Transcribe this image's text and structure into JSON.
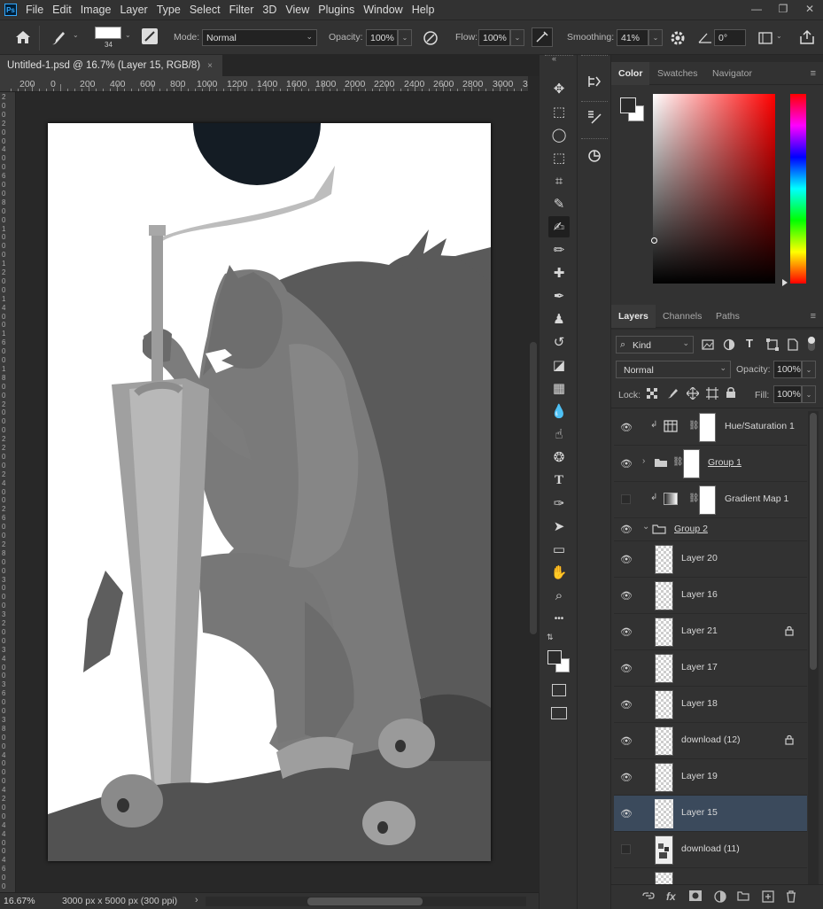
{
  "app": {
    "logo_text": "Ps"
  },
  "menu": [
    "File",
    "Edit",
    "Image",
    "Layer",
    "Type",
    "Select",
    "Filter",
    "3D",
    "View",
    "Plugins",
    "Window",
    "Help"
  ],
  "window_controls": {
    "minimize": "—",
    "restore": "❐",
    "close": "✕"
  },
  "options_bar": {
    "brush_size": "34",
    "mode_label": "Mode:",
    "mode_value": "Normal",
    "opacity_label": "Opacity:",
    "opacity_value": "100%",
    "flow_label": "Flow:",
    "flow_value": "100%",
    "smoothing_label": "Smoothing:",
    "smoothing_value": "41%",
    "angle_value": "0°"
  },
  "document": {
    "tab_title": "Untitled-1.psd @ 16.7% (Layer 15, RGB/8)",
    "tab_close": "×",
    "ruler_top_labels": [
      "200",
      "0",
      "200",
      "400",
      "600",
      "800",
      "1000",
      "1200",
      "1400",
      "1600",
      "1800",
      "2000",
      "2200",
      "2400",
      "2600",
      "2800",
      "3000",
      "3"
    ],
    "ruler_left_labels": [
      "2",
      "0",
      "0",
      "2",
      "0",
      "0",
      "4",
      "0",
      "0",
      "6",
      "0",
      "0",
      "8",
      "0",
      "0",
      "1",
      "0",
      "0",
      "0",
      "1",
      "2",
      "0",
      "0",
      "1",
      "4",
      "0",
      "0",
      "1",
      "6",
      "0",
      "0",
      "1",
      "8",
      "0",
      "0",
      "2",
      "0",
      "0",
      "0",
      "2",
      "2",
      "0",
      "0",
      "2",
      "4",
      "0",
      "0",
      "2",
      "6",
      "0",
      "0",
      "2",
      "8",
      "0",
      "0",
      "3",
      "0",
      "0",
      "0",
      "3",
      "2",
      "0",
      "0",
      "3",
      "4",
      "0",
      "0",
      "3",
      "6",
      "0",
      "0",
      "3",
      "8",
      "0",
      "0",
      "4",
      "0",
      "0",
      "0",
      "4",
      "2",
      "0",
      "0",
      "4",
      "4",
      "0",
      "0",
      "4",
      "6",
      "0",
      "0"
    ],
    "status_zoom": "16.67%",
    "status_docsize": "3000 px x 5000 px (300 ppi)",
    "status_arrow": "›"
  },
  "tools": [
    {
      "name": "move-tool",
      "glyph": "✥"
    },
    {
      "name": "marquee-tool",
      "glyph": "⬚"
    },
    {
      "name": "lasso-tool",
      "glyph": "◯"
    },
    {
      "name": "object-select-tool",
      "glyph": "⬚"
    },
    {
      "name": "crop-tool",
      "glyph": "⌗"
    },
    {
      "name": "eyedropper-tool",
      "glyph": "✎"
    },
    {
      "name": "brush-tool",
      "glyph": "✍"
    },
    {
      "name": "pencil-tool",
      "glyph": "✏"
    },
    {
      "name": "healing-brush-tool",
      "glyph": "✚"
    },
    {
      "name": "mixer-brush-tool",
      "glyph": "✒"
    },
    {
      "name": "clone-stamp-tool",
      "glyph": "♟"
    },
    {
      "name": "history-brush-tool",
      "glyph": "↺"
    },
    {
      "name": "eraser-tool",
      "glyph": "◪"
    },
    {
      "name": "gradient-tool",
      "glyph": "▦"
    },
    {
      "name": "blur-tool",
      "glyph": "💧"
    },
    {
      "name": "smudge-tool",
      "glyph": "☝"
    },
    {
      "name": "sponge-tool",
      "glyph": "❂"
    },
    {
      "name": "type-tool",
      "glyph": "T"
    },
    {
      "name": "pen-tool",
      "glyph": "✑"
    },
    {
      "name": "path-select-tool",
      "glyph": "➤"
    },
    {
      "name": "rectangle-tool",
      "glyph": "▭"
    },
    {
      "name": "hand-tool",
      "glyph": "✋"
    },
    {
      "name": "zoom-tool",
      "glyph": "⌕"
    },
    {
      "name": "more-tools",
      "glyph": "•••"
    }
  ],
  "color_panel": {
    "tabs": [
      "Color",
      "Swatches",
      "Navigator"
    ],
    "menu_glyph": "≡"
  },
  "layers_panel": {
    "tabs": [
      "Layers",
      "Channels",
      "Paths"
    ],
    "kind_label": "Kind",
    "blend_mode": "Normal",
    "opacity_label": "Opacity:",
    "opacity_value": "100%",
    "lock_label": "Lock:",
    "fill_label": "Fill:",
    "fill_value": "100%",
    "layers": [
      {
        "name": "Hue/Saturation 1",
        "visible": true,
        "type": "adjustment-hue",
        "clipped": true
      },
      {
        "name": "Group 1",
        "visible": true,
        "type": "group-collapsed"
      },
      {
        "name": "Gradient Map 1",
        "visible": false,
        "type": "adjustment-gradient",
        "clipped": true
      },
      {
        "name": "Group 2",
        "visible": true,
        "type": "group-expanded"
      },
      {
        "name": "Layer 20",
        "visible": true,
        "type": "pixel"
      },
      {
        "name": "Layer 16",
        "visible": true,
        "type": "pixel"
      },
      {
        "name": "Layer 21",
        "visible": true,
        "type": "pixel",
        "locked": true
      },
      {
        "name": "Layer 17",
        "visible": true,
        "type": "pixel"
      },
      {
        "name": "Layer 18",
        "visible": true,
        "type": "pixel"
      },
      {
        "name": "download (12)",
        "visible": true,
        "type": "pixel",
        "locked": true
      },
      {
        "name": "Layer 19",
        "visible": true,
        "type": "pixel"
      },
      {
        "name": "Layer 15",
        "visible": true,
        "type": "pixel",
        "selected": true
      },
      {
        "name": "download (11)",
        "visible": false,
        "type": "pixel"
      }
    ]
  }
}
